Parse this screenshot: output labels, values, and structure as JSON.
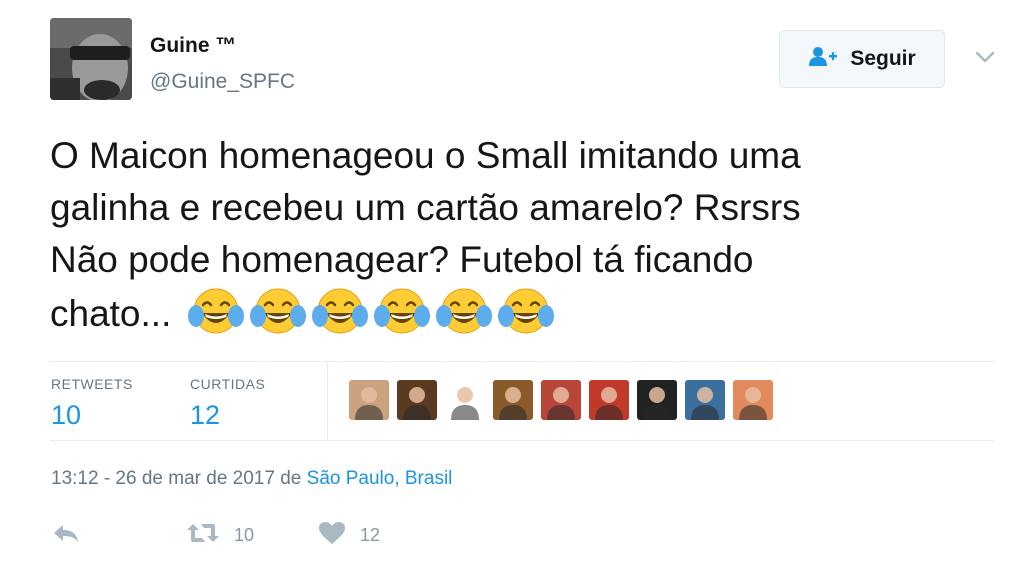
{
  "user": {
    "name": "Guine ™",
    "handle": "@Guine_SPFC"
  },
  "follow": {
    "label": "Seguir",
    "icon": "follow-user-icon"
  },
  "menu_icon": "chevron-down-icon",
  "tweet": {
    "lines": [
      "O Maicon homenageou o Small imitando uma",
      "galinha e recebeu um cartão amarelo? Rsrsrs",
      "Não pode homenagear? Futebol tá ficando",
      "chato..."
    ],
    "emoji": "face-with-tears-of-joy",
    "emoji_count": 6
  },
  "stats": {
    "retweets_label": "RETWEETS",
    "retweets_value": "10",
    "likes_label": "CURTIDAS",
    "likes_value": "12"
  },
  "likers": [
    {
      "name": "liker-1",
      "color": "#c9a27e"
    },
    {
      "name": "liker-2",
      "color": "#5b3a22"
    },
    {
      "name": "liker-3",
      "color": "#ffffff"
    },
    {
      "name": "liker-4",
      "color": "#8a5a2b"
    },
    {
      "name": "liker-5",
      "color": "#b8463a"
    },
    {
      "name": "liker-6",
      "color": "#c0392b"
    },
    {
      "name": "liker-7",
      "color": "#222222"
    },
    {
      "name": "liker-8",
      "color": "#3a6f9e"
    },
    {
      "name": "liker-9",
      "color": "#e08a5e"
    }
  ],
  "timestamp": {
    "time_date": "13:12 - 26 de mar de 2017 de ",
    "place": "São Paulo, Brasil"
  },
  "actions": {
    "reply_icon": "reply-icon",
    "retweet_icon": "retweet-icon",
    "retweet_count": "10",
    "like_icon": "heart-icon",
    "like_count": "12"
  },
  "colors": {
    "link": "#1b95e0",
    "muted": "#657786",
    "text": "#14171a",
    "border": "#e6ecf0"
  }
}
